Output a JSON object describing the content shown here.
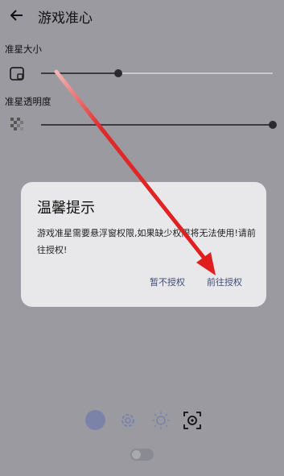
{
  "header": {
    "title": "游戏准心"
  },
  "settings": {
    "size_label": "准星大小",
    "transparency_label": "准星透明度"
  },
  "dialog": {
    "title": "温馨提示",
    "message": "游戏准星需要悬浮窗权限,如果缺少权限将无法使用!请前往授权!",
    "cancel_label": "暂不授权",
    "confirm_label": "前往授权"
  },
  "controls": {
    "size_slider_level": 0.29,
    "transparency_slider_level": 1.0,
    "toggle_on": false
  },
  "colors": {
    "accent": "#3f4b76",
    "dot": "#7b84a8",
    "arrow": "#e01e1e"
  },
  "icons": [
    "back-arrow-icon",
    "crosshair-size-icon",
    "transparency-icon",
    "color-dot-icon",
    "gear-icon",
    "sun-icon",
    "target-crosshair-icon"
  ]
}
